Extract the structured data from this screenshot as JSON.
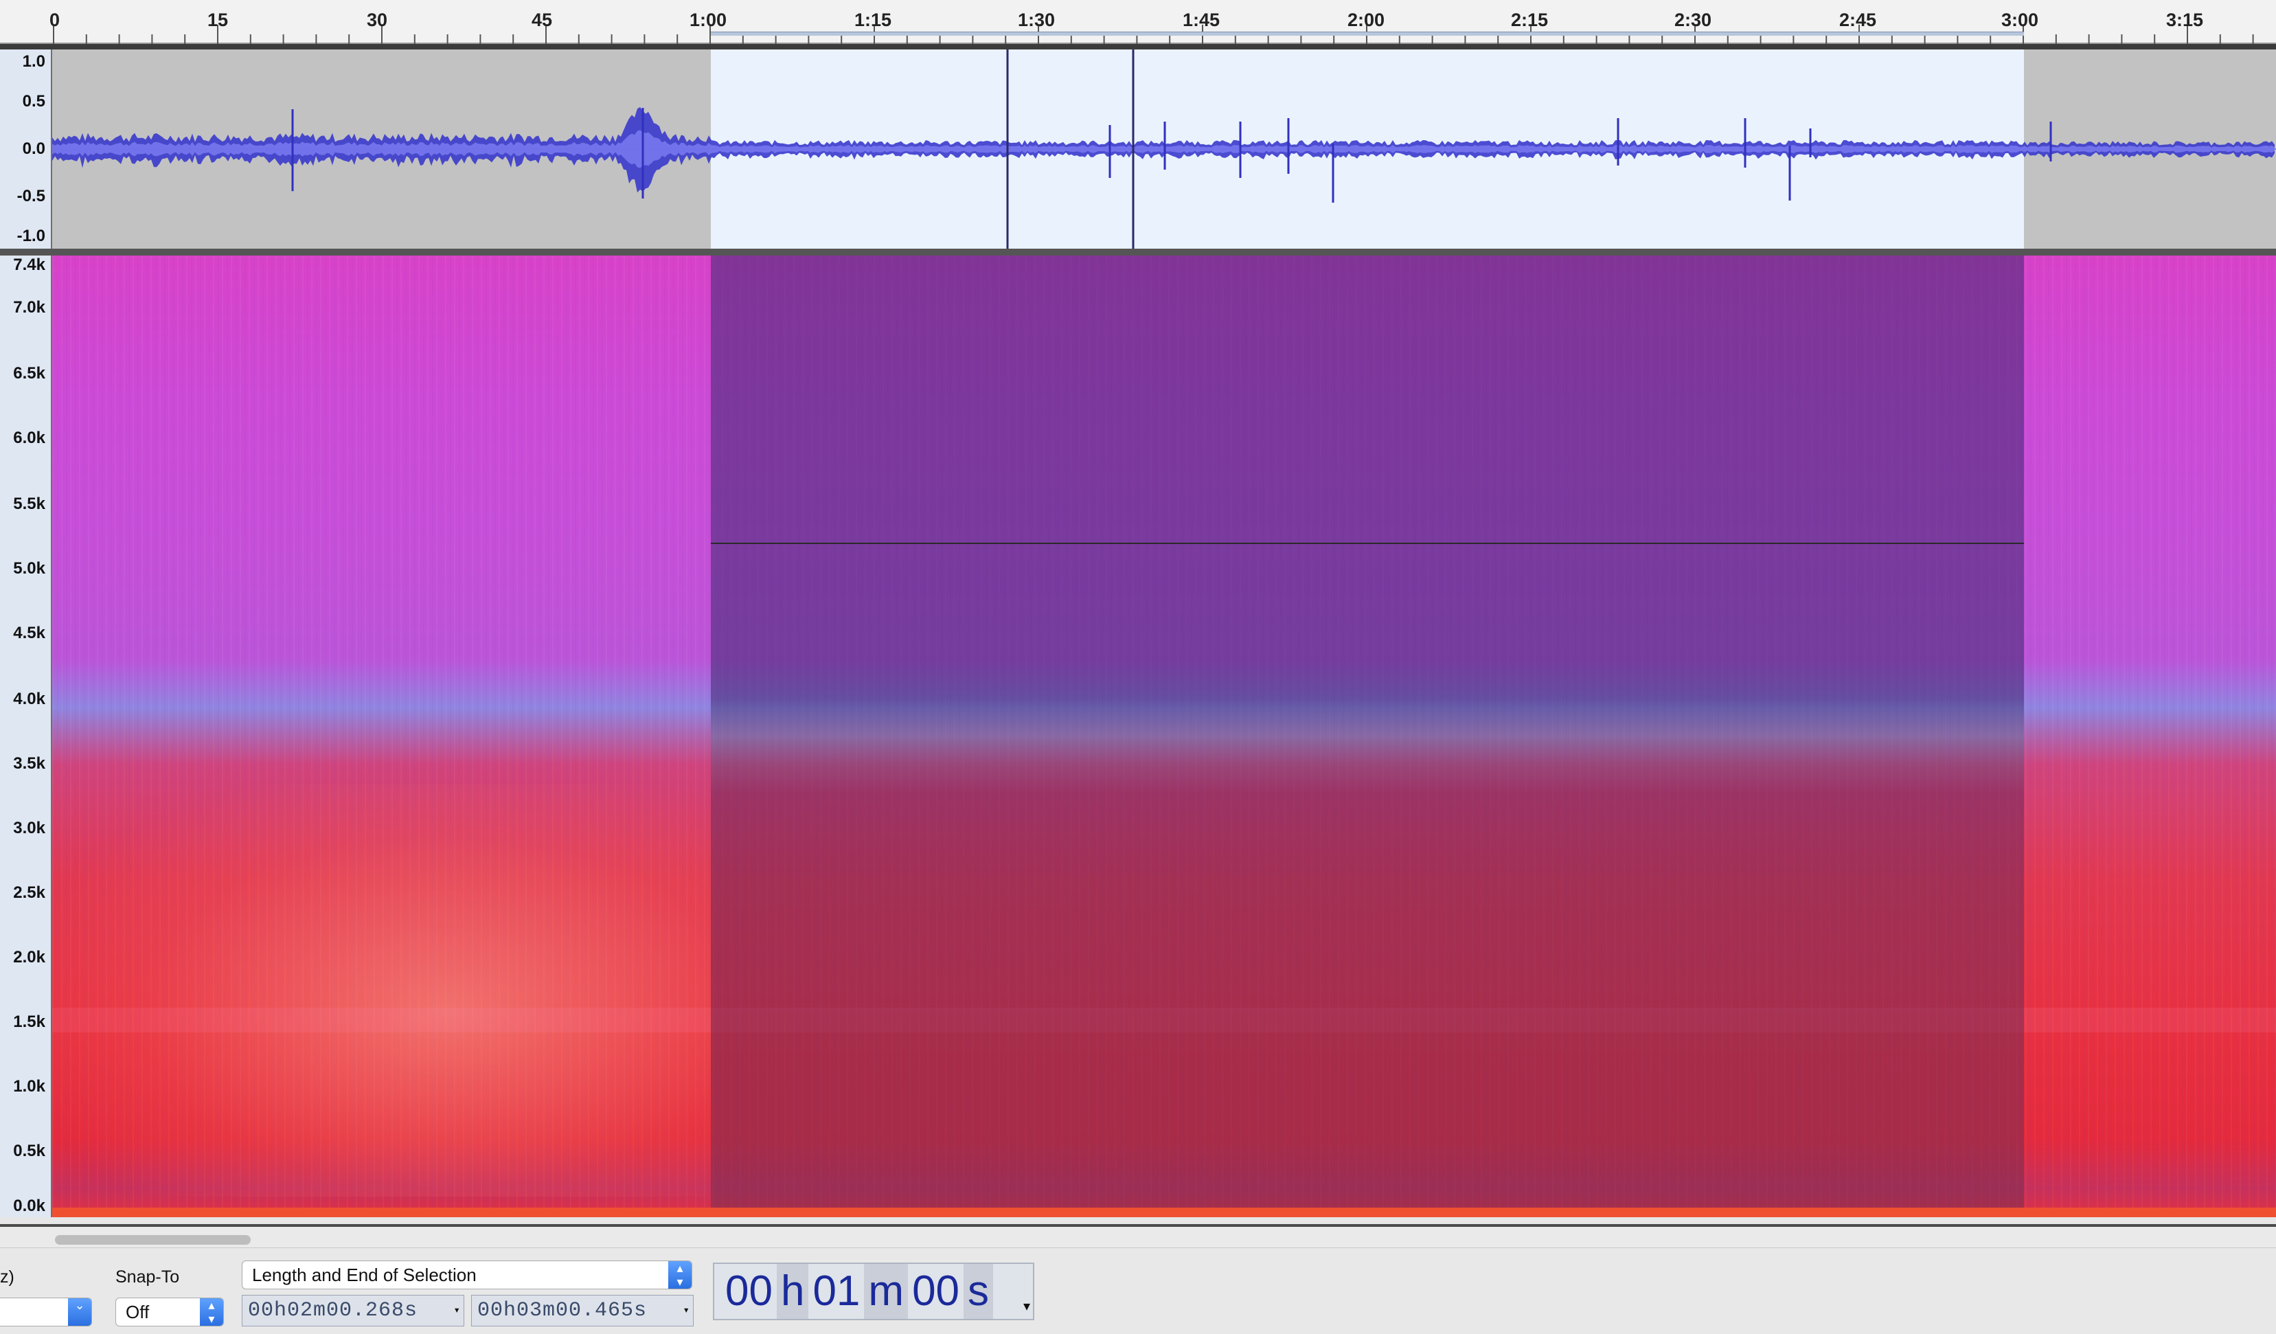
{
  "timeline": {
    "ticks": [
      "0",
      "15",
      "30",
      "45",
      "1:00",
      "1:15",
      "1:30",
      "1:45",
      "2:00",
      "2:15",
      "2:30",
      "2:45",
      "3:00",
      "3:15"
    ]
  },
  "waveform": {
    "scale": [
      "1.0",
      "0.5",
      "0.0",
      "-0.5",
      "-1.0"
    ]
  },
  "spectrogram": {
    "scale": [
      "7.4k",
      "7.0k",
      "6.5k",
      "6.0k",
      "5.5k",
      "5.0k",
      "4.5k",
      "4.0k",
      "3.5k",
      "3.0k",
      "2.5k",
      "2.0k",
      "1.5k",
      "1.0k",
      "0.5k",
      "0.0k"
    ]
  },
  "toolbar": {
    "project_rate_partial": "z)",
    "snap_to_label": "Snap-To",
    "snap_to_value": "Off",
    "selection_mode": "Length and End of Selection",
    "length_value": "00h02m00.268s",
    "end_value": "00h03m00.465s",
    "audio_position": {
      "hours": "00",
      "h": "h",
      "minutes": "01",
      "m": "m",
      "seconds": "00",
      "s": "s"
    }
  },
  "colors": {
    "waveform": "#3a3acc",
    "selection_background": "#eaf2fd",
    "time_text": "#1a2a9a"
  }
}
